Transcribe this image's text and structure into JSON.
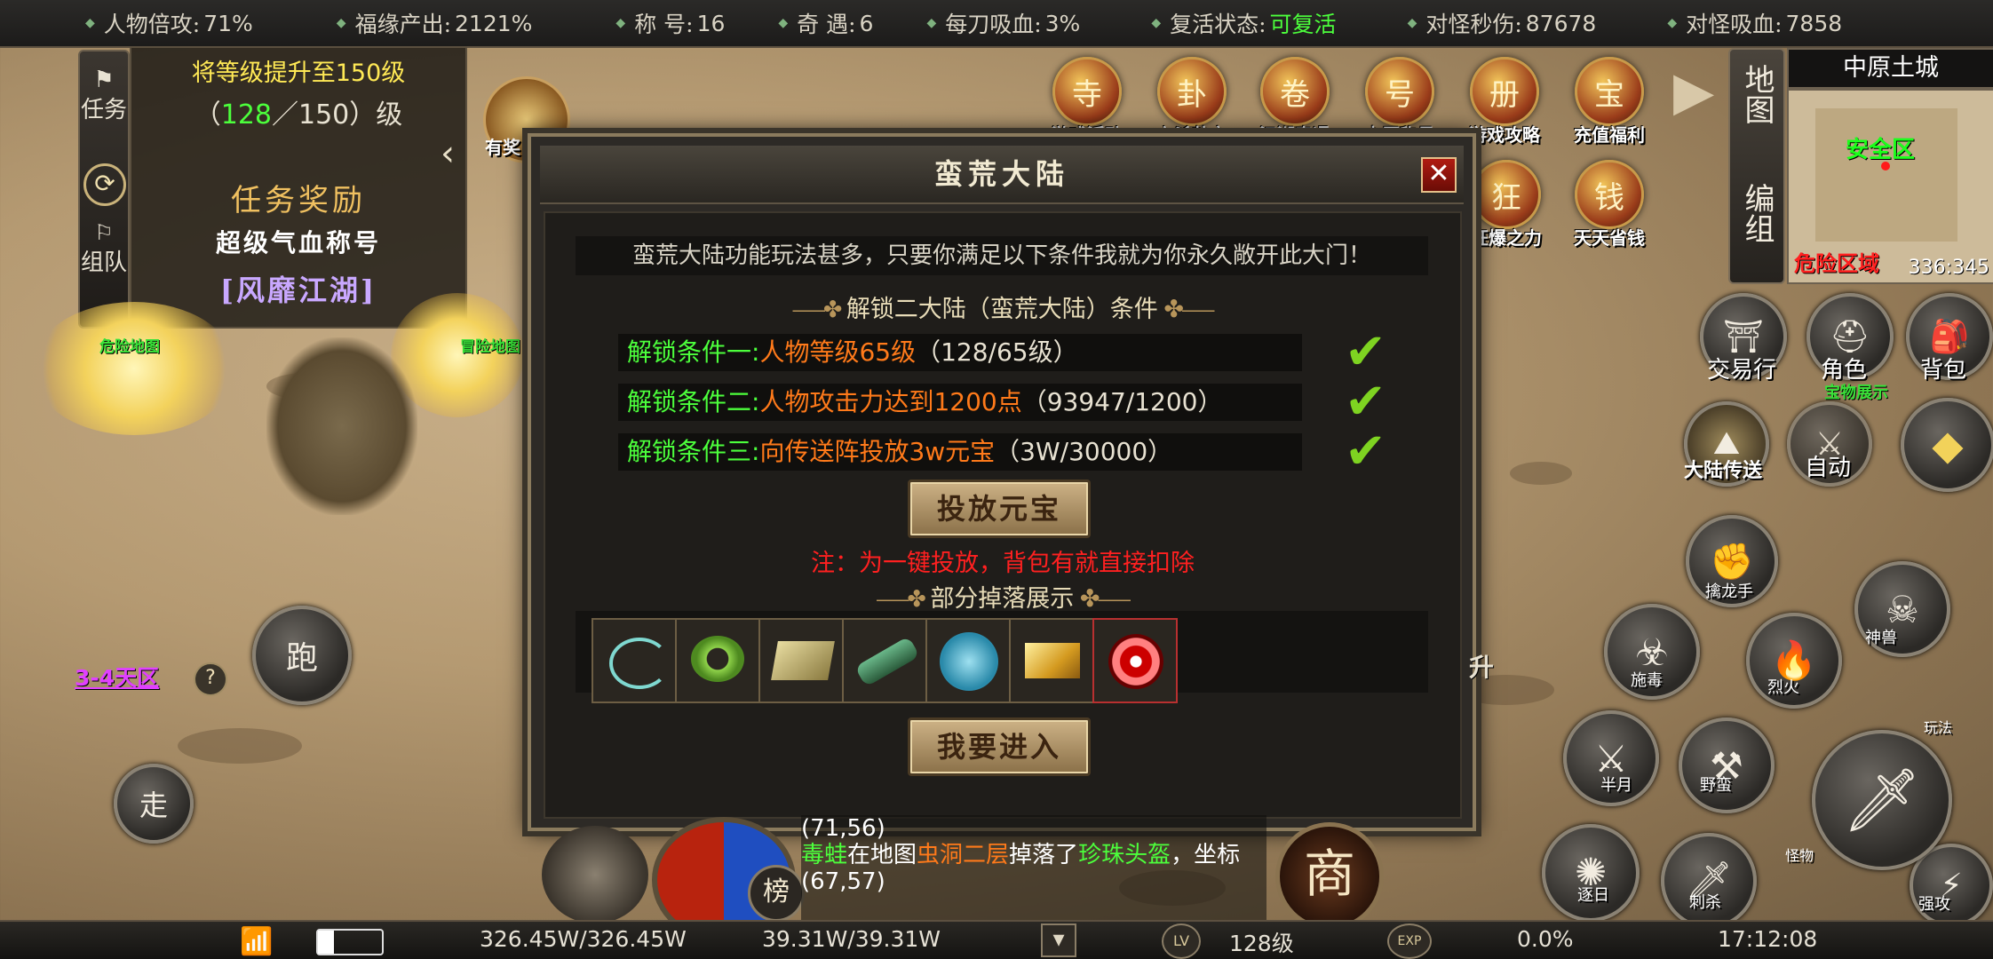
{
  "top_stats": [
    {
      "label": "人物倍攻:",
      "value": "71%"
    },
    {
      "label": "福缘产出:",
      "value": "2121%"
    },
    {
      "label": "称 号:",
      "value": "16"
    },
    {
      "label": "奇 遇:",
      "value": "6"
    },
    {
      "label": "每刀吸血:",
      "value": "3%"
    },
    {
      "label": "复活状态:",
      "value": "可复活"
    },
    {
      "label": "对怪秒伤:",
      "value": "87678"
    },
    {
      "label": "对怪吸血:",
      "value": "7858"
    }
  ],
  "quest": {
    "tab_task": "任务",
    "tab_team": "组队",
    "goal": "将等级提升至150级",
    "progress_open": "（",
    "progress_current": "128",
    "progress_rest": "／150）级",
    "reward_title": "任务奖励",
    "reward_item": "超级气血称号",
    "reward_title_name": "[风靡江湖]"
  },
  "map_labels": {
    "danger_map": "危险地图",
    "adventure_map": "冒险地图",
    "reward": "有奖",
    "zone": "3-4天区"
  },
  "top_icons": [
    "游戏活动",
    "六爻卦文",
    "江湖奇遇",
    "中原称号",
    "游戏攻略",
    "充值福利",
    "狂爆之力",
    "天天省钱"
  ],
  "minimap": {
    "tab_map": "地图",
    "tab_group": "编组",
    "title": "中原土城",
    "safe_zone": "安全区",
    "danger_zone": "危险区域",
    "coords": "336:345"
  },
  "right_buttons": {
    "trade": "交易行",
    "role": "角色",
    "bag": "背包",
    "treasure": "宝物展示",
    "continent": "大陆传送",
    "auto": "自动"
  },
  "skills": [
    "擒龙手",
    "神兽",
    "施毒",
    "烈火",
    "半月",
    "野蛮",
    "逐日",
    "刺杀",
    "强攻",
    "玩法",
    "怪物"
  ],
  "left_controls": {
    "run": "跑",
    "walk": "走"
  },
  "modal": {
    "title": "蛮荒大陆",
    "close": "✕",
    "intro": "蛮荒大陆功能玩法甚多，只要你满足以下条件我就为你永久敞开此大门！",
    "section_unlock": "解锁二大陆（蛮荒大陆）条件",
    "conditions": [
      {
        "label": "解锁条件一:",
        "value": "人物等级65级",
        "progress": "（128/65级）"
      },
      {
        "label": "解锁条件二:",
        "value": "人物攻击力达到1200点",
        "progress": "（93947/1200）"
      },
      {
        "label": "解锁条件三:",
        "value": "向传送阵投放3w元宝",
        "progress": "（3W/30000）"
      }
    ],
    "deposit_button": "投放元宝",
    "note": "注：为一键投放，背包有就直接扣除",
    "section_drops": "部分掉落展示",
    "enter_button": "我要进入"
  },
  "chat": {
    "line1": "(71,56)",
    "player": "毒蛙",
    "mid1": "在地图",
    "map": "虫洞二层",
    "mid2": "掉落了",
    "item": "珍珠头盔",
    "tail": "，坐标",
    "line3": "(67,57)"
  },
  "shop_label": "商",
  "rank_label": "榜",
  "lift_label": "升",
  "bottom": {
    "hp": "326.45W/326.45W",
    "mp": "39.31W/39.31W",
    "lv_badge": "LV",
    "level": "128级",
    "exp_badge": "EXP",
    "exp": "0.0%",
    "time": "17:12:08"
  },
  "colors": {
    "green": "#4cff3c",
    "orange": "#ff7a1a",
    "red": "#ff2020",
    "purple": "#c9a8ff",
    "gold": "#f0c060"
  }
}
